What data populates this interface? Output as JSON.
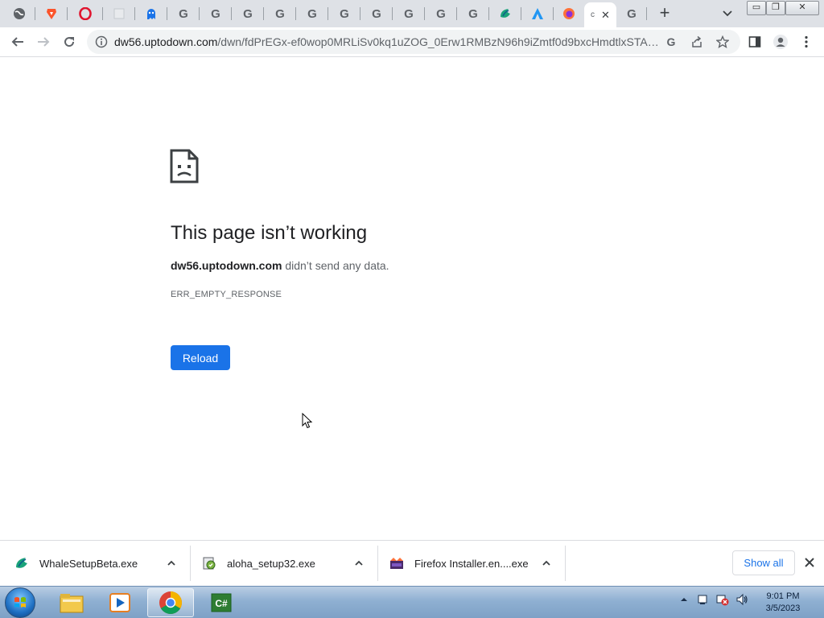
{
  "tabs": {
    "active_tab_title": "c",
    "active_tab_close": "✕",
    "new_tab_symbol": "+",
    "google_letter": "G"
  },
  "toolbar": {
    "url_host": "dw56.uptodown.com",
    "url_path": "/dwn/fdPrEGx-ef0wop0MRLiSv0kq1uZOG_0Erw1RMBzN96h9iZmtf0d9bxcHmdtlxSTAG..."
  },
  "window_controls": {
    "minimize": "▭",
    "restore": "❐",
    "close": "✕"
  },
  "error_page": {
    "title": "This page isn’t working",
    "host": "dw56.uptodown.com",
    "message_suffix": " didn’t send any data.",
    "error_code": "ERR_EMPTY_RESPONSE",
    "reload_label": "Reload"
  },
  "downloads": {
    "items": [
      {
        "name": "WhaleSetupBeta.exe",
        "icon": "whale-icon"
      },
      {
        "name": "aloha_setup32.exe",
        "icon": "installer-icon"
      },
      {
        "name": "Firefox Installer.en....exe",
        "icon": "firefox-installer-icon"
      }
    ],
    "show_all_label": "Show all"
  },
  "taskbar": {
    "time": "9:01 PM",
    "date": "3/5/2023",
    "apps": [
      "file-explorer-icon",
      "media-player-icon",
      "chrome-icon",
      "csharp-icon"
    ]
  },
  "colors": {
    "accent": "#1a73e8",
    "tabstrip": "#dee1e6",
    "omnibox": "#f1f3f4"
  }
}
